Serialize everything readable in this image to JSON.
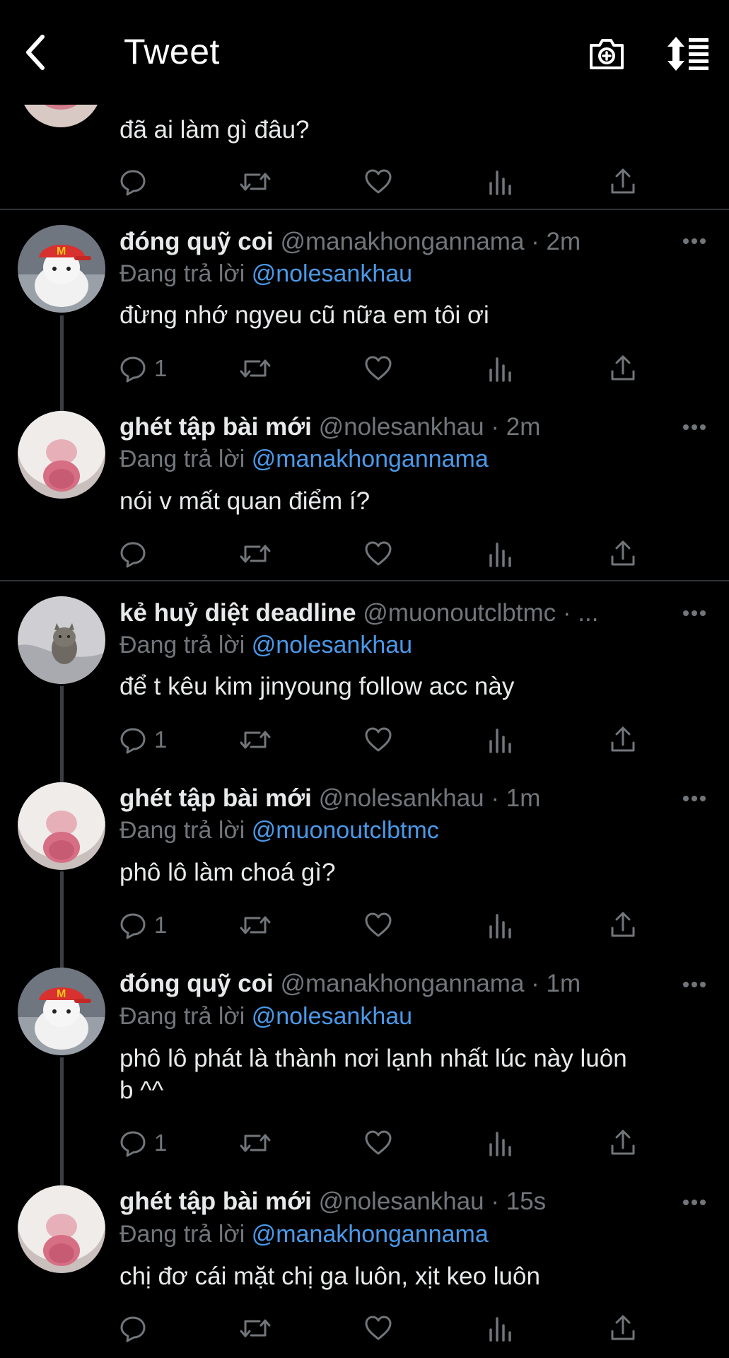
{
  "header": {
    "title": "Tweet"
  },
  "partial_tweet": {
    "text": "đã ai làm gì đâu?"
  },
  "reply_prefix": "Đang trả lời",
  "tweets": [
    {
      "name": "đóng quỹ coi",
      "handle": "@manakhongannama",
      "time": "· 2m",
      "reply_to": "@nolesankhau",
      "text": "đừng nhớ ngyeu cũ nữa em tôi ơi",
      "reply_count": "1",
      "avatar": "rabbit-cap"
    },
    {
      "name": "ghét tập bài mới",
      "handle": "@nolesankhau",
      "time": "· 2m",
      "reply_to": "@manakhongannama",
      "text": "nói v mất quan điểm í?",
      "reply_count": "",
      "avatar": "hamster"
    },
    {
      "name": "kẻ huỷ diệt deadline",
      "handle": "@muonoutclbtmc",
      "time": "· ...",
      "reply_to": "@nolesankhau",
      "text": "để t kêu kim jinyoung follow acc này",
      "reply_count": "1",
      "avatar": "cat"
    },
    {
      "name": "ghét tập bài mới",
      "handle": "@nolesankhau",
      "time": "· 1m",
      "reply_to": "@muonoutclbtmc",
      "text": "phô lô làm choá gì?",
      "reply_count": "1",
      "avatar": "hamster"
    },
    {
      "name": "đóng quỹ coi",
      "handle": "@manakhongannama",
      "time": "· 1m",
      "reply_to": "@nolesankhau",
      "text": "phô lô phát là thành nơi lạnh nhất lúc này luôn",
      "text2": "b ^^",
      "reply_count": "1",
      "avatar": "rabbit-cap"
    },
    {
      "name": "ghét tập bài mới",
      "handle": "@nolesankhau",
      "time": "· 15s",
      "reply_to": "@manakhongannama",
      "text": "chị đơ cái mặt chị ga luôn, xịt keo luôn",
      "reply_count": "",
      "avatar": "hamster"
    }
  ],
  "icons": [
    "back-arrow-icon",
    "camera-plus-icon",
    "sort-icon",
    "reply-icon",
    "retweet-icon",
    "like-icon",
    "analytics-icon",
    "share-icon",
    "more-icon"
  ],
  "colors": {
    "background": "#000000",
    "text": "#e7e9ea",
    "secondary": "#71767b",
    "link": "#4a99e9",
    "divider": "#2f3336"
  }
}
